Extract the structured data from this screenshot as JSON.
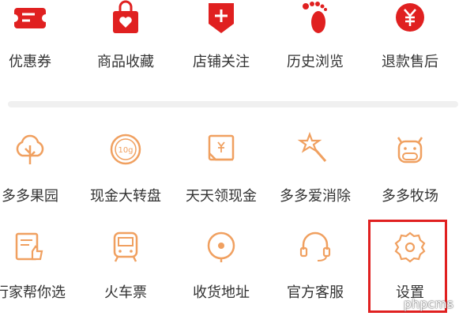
{
  "colors": {
    "red": "#e02020",
    "orange": "#f0a060",
    "text": "#333333"
  },
  "top_menu": [
    {
      "label": "优惠券",
      "icon": "coupon-icon"
    },
    {
      "label": "商品收藏",
      "icon": "favorite-bag-icon"
    },
    {
      "label": "店铺关注",
      "icon": "store-follow-icon"
    },
    {
      "label": "历史浏览",
      "icon": "footprint-icon"
    },
    {
      "label": "退款售后",
      "icon": "refund-icon"
    }
  ],
  "grid_row1": [
    {
      "label": "多多果园",
      "icon": "tree-icon"
    },
    {
      "label": "现金大转盘",
      "icon": "spin-wheel-icon"
    },
    {
      "label": "天天领现金",
      "icon": "cash-envelope-icon"
    },
    {
      "label": "多多爱消除",
      "icon": "star-wand-icon"
    },
    {
      "label": "多多牧场",
      "icon": "cow-icon"
    }
  ],
  "grid_row2": [
    {
      "label": "行家帮你选",
      "icon": "thumbs-up-doc-icon"
    },
    {
      "label": "火车票",
      "icon": "train-icon"
    },
    {
      "label": "收货地址",
      "icon": "location-pin-icon"
    },
    {
      "label": "官方客服",
      "icon": "headset-icon"
    },
    {
      "label": "设置",
      "icon": "gear-icon"
    }
  ],
  "watermark": "phpcms"
}
